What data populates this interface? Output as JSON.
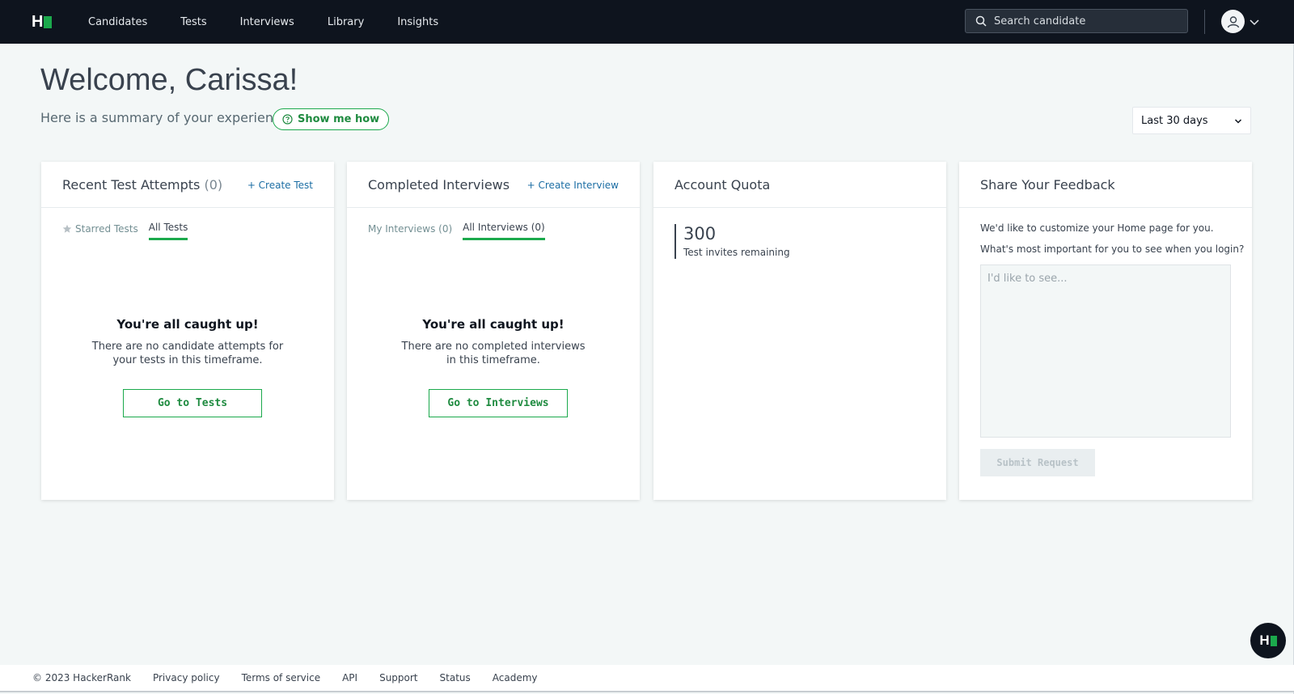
{
  "nav": {
    "logo_text": "H",
    "links": [
      "Candidates",
      "Tests",
      "Interviews",
      "Library",
      "Insights"
    ],
    "search_placeholder": "Search candidate"
  },
  "header": {
    "welcome": "Welcome, Carissa!",
    "summary": "Here is a summary of your experience.",
    "show_me_how": "Show me how",
    "range": "Last 30 days"
  },
  "cards": {
    "tests": {
      "title": "Recent Test Attempts",
      "count": "(0)",
      "action": "+ Create Test",
      "tabs": [
        "Starred Tests",
        "All Tests"
      ],
      "empty_title": "You're all caught up!",
      "empty_text": "There are no candidate attempts for your tests in this timeframe.",
      "button": "Go to Tests"
    },
    "interviews": {
      "title": "Completed Interviews",
      "action": "+ Create Interview",
      "tabs": [
        "My Interviews (0)",
        "All Interviews (0)"
      ],
      "empty_title": "You're all caught up!",
      "empty_text": "There are no completed interviews in this timeframe.",
      "button": "Go to Interviews"
    },
    "quota": {
      "title": "Account Quota",
      "number": "300",
      "label": "Test invites remaining"
    },
    "feedback": {
      "title": "Share Your Feedback",
      "line1": "We'd like to customize your Home page for you.",
      "line2": "What's most important for you to see when you login?",
      "placeholder": "I'd like to see...",
      "submit": "Submit Request"
    }
  },
  "footer": {
    "copyright": "© 2023 HackerRank",
    "links": [
      "Privacy policy",
      "Terms of service",
      "API",
      "Support",
      "Status",
      "Academy"
    ]
  },
  "colors": {
    "nav_bg": "#0e141e",
    "accent_green": "#1ba94c",
    "link_blue": "#1c6ea4",
    "page_bg": "#f3f7f7"
  }
}
